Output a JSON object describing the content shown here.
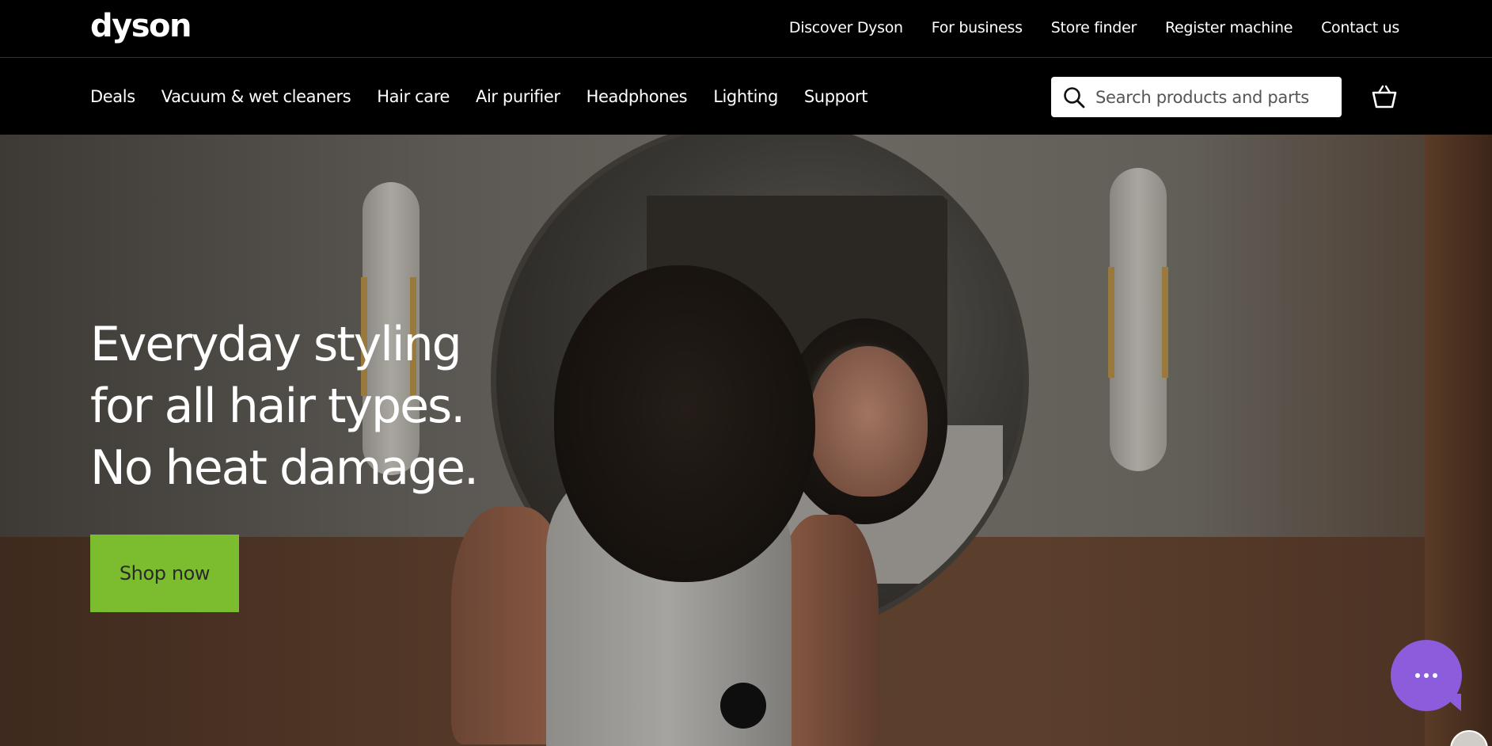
{
  "brand": {
    "logo_text": "dyson"
  },
  "utility_nav": [
    {
      "label": "Discover Dyson"
    },
    {
      "label": "For business"
    },
    {
      "label": "Store finder"
    },
    {
      "label": "Register machine"
    },
    {
      "label": "Contact us"
    }
  ],
  "main_nav": [
    {
      "label": "Deals"
    },
    {
      "label": "Vacuum & wet cleaners"
    },
    {
      "label": "Hair care"
    },
    {
      "label": "Air purifier"
    },
    {
      "label": "Headphones"
    },
    {
      "label": "Lighting"
    },
    {
      "label": "Support"
    }
  ],
  "search": {
    "placeholder": "Search products and parts",
    "icon": "search-icon"
  },
  "basket": {
    "icon": "basket-icon"
  },
  "hero": {
    "title": "Everyday styling for all hair types. No heat damage.",
    "cta_label": "Shop now",
    "cta_color": "#7bbd2e"
  },
  "chat": {
    "icon": "chat-bubble-icon",
    "color": "#8b5cdc"
  }
}
